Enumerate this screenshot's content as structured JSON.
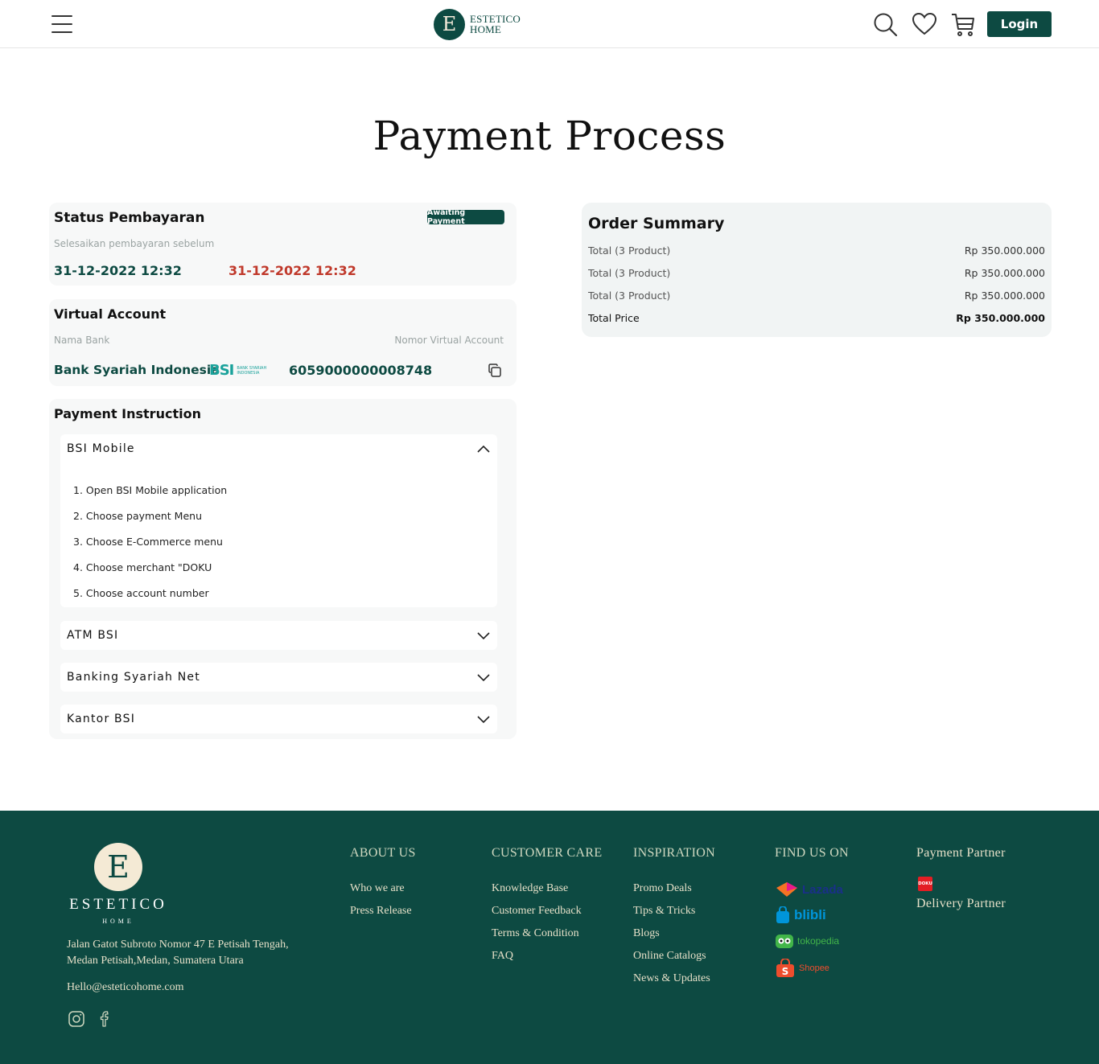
{
  "header": {
    "logo_line1": "ESTETICO",
    "logo_line2": "HOME",
    "logo_letter": "E",
    "login_label": "Login"
  },
  "page": {
    "title": "Payment Process"
  },
  "status": {
    "title": "Status Pembayaran",
    "badge": "Awaiting Payment",
    "subtitle": "Selesaikan pembayaran sebelum",
    "date_primary": "31-12-2022 12:32",
    "date_deadline": "31-12-2022 12:32"
  },
  "virtual_account": {
    "title": "Virtual Account",
    "bank_label": "Nama Bank",
    "number_label": "Nomor Virtual Account",
    "bank_name": "Bank Syariah Indonesia",
    "bank_logo_text": "BSI",
    "bank_logo_sub1": "BANK SYARIAH",
    "bank_logo_sub2": "INDONESIA",
    "number": "6059000000008748"
  },
  "instruction": {
    "title": "Payment Instruction",
    "sections": [
      {
        "label": "BSI Mobile",
        "expanded": true,
        "steps": [
          "1. Open BSI Mobile application",
          "2. Choose payment Menu",
          "3. Choose E-Commerce menu",
          "4. Choose merchant \"DOKU",
          "5. Choose account number"
        ]
      },
      {
        "label": "ATM BSI",
        "expanded": false
      },
      {
        "label": "Banking Syariah Net",
        "expanded": false
      },
      {
        "label": "Kantor BSI",
        "expanded": false
      }
    ]
  },
  "order_summary": {
    "title": "Order Summary",
    "rows": [
      {
        "label": "Total (3 Product)",
        "value": "Rp 350.000.000"
      },
      {
        "label": "Total (3 Product)",
        "value": "Rp 350.000.000"
      },
      {
        "label": "Total (3 Product)",
        "value": "Rp 350.000.000"
      }
    ],
    "total_label": "Total Price",
    "total_value": "Rp 350.000.000"
  },
  "footer": {
    "brand": "ESTETICO",
    "brand_sub": "HOME",
    "address": "Jalan Gatot Subroto Nomor 47 E Petisah Tengah, Medan Petisah,Medan, Sumatera Utara",
    "email": "Hello@esteticohome.com",
    "about": {
      "heading": "ABOUT US",
      "links": [
        "Who we are",
        "Press Release"
      ]
    },
    "care": {
      "heading": "CUSTOMER CARE",
      "links": [
        "Knowledge Base",
        "Customer Feedback",
        "Terms & Condition",
        "FAQ"
      ]
    },
    "inspiration": {
      "heading": "INSPIRATION",
      "links": [
        "Promo Deals",
        "Tips & Tricks",
        "Blogs",
        "Online Catalogs",
        "News & Updates"
      ]
    },
    "find_us": {
      "heading": "FIND US ON",
      "marketplaces": [
        "Lazada",
        "blibli",
        "tokopedia",
        "Shopee"
      ]
    },
    "payment_partner": "Payment Partner",
    "payment_partner_logo": "DOKU",
    "delivery_partner": "Delivery Partner"
  },
  "colors": {
    "primary": "#0d4a42",
    "deadline_red": "#c0392b",
    "bsi_teal": "#1aa29b",
    "footer_text": "#e6e0c8"
  },
  "icons": [
    "menu-icon",
    "search-icon",
    "heart-icon",
    "cart-icon",
    "copy-icon",
    "chevron-up-icon",
    "chevron-down-icon",
    "instagram-icon",
    "facebook-icon"
  ]
}
